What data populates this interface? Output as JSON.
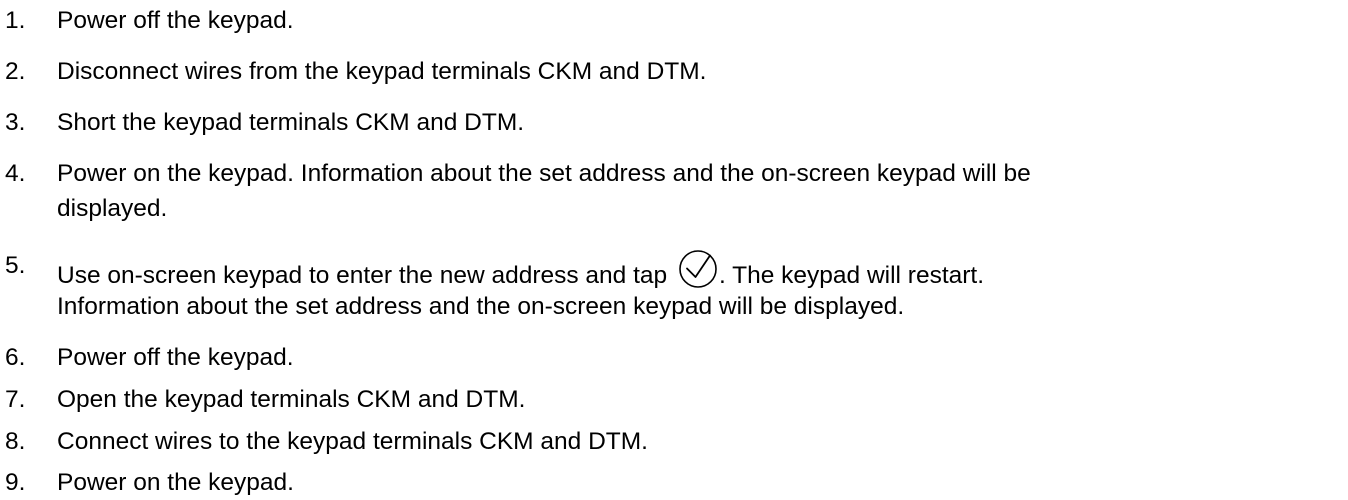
{
  "steps": [
    {
      "number": "1.",
      "text": "Power off the keypad."
    },
    {
      "number": "2.",
      "text": "Disconnect wires from the keypad terminals CKM and DTM."
    },
    {
      "number": "3.",
      "text": "Short the keypad terminals CKM and DTM."
    },
    {
      "number": "4.",
      "line1": "Power on the keypad. Information about the set address and the on-screen keypad will be",
      "line2": "displayed."
    },
    {
      "number": "5.",
      "line1_before_icon": "Use on-screen keypad to enter the new address and tap",
      "icon": "check-circle-icon",
      "line1_after_icon": ". The keypad will restart.",
      "line2": "Information about the set address and the on-screen keypad will be displayed."
    },
    {
      "number": "6.",
      "text": "Power off the keypad."
    },
    {
      "number": "7.",
      "text": "Open the keypad terminals CKM and DTM."
    },
    {
      "number": "8.",
      "text": "Connect wires to the keypad terminals CKM and DTM."
    },
    {
      "number": "9.",
      "text": "Power on the keypad."
    }
  ]
}
